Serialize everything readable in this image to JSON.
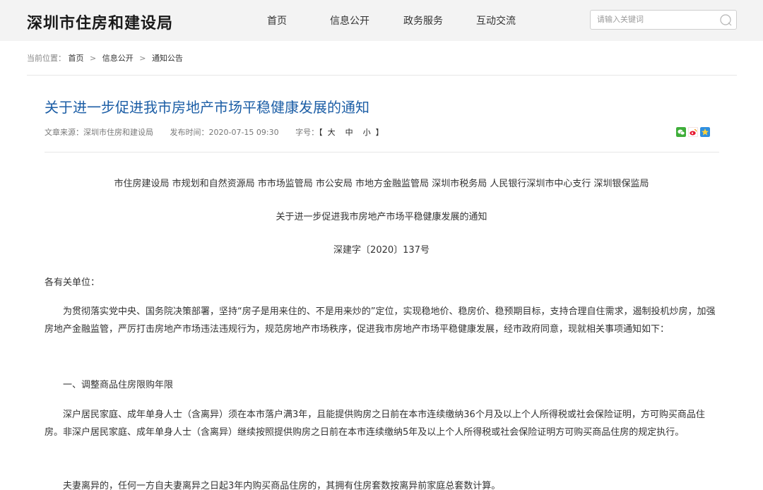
{
  "header": {
    "site_title": "深圳市住房和建设局",
    "nav": [
      "首页",
      "信息公开",
      "政务服务",
      "互动交流"
    ],
    "search_placeholder": "请输入关键词"
  },
  "breadcrumb": {
    "label": "当前位置：",
    "items": [
      "首页",
      "信息公开",
      "通知公告"
    ],
    "separator": ">"
  },
  "article": {
    "title": "关于进一步促进我市房地产市场平稳健康发展的通知",
    "source": "文章来源：深圳市住房和建设局",
    "published": "发布时间：2020-07-15 09:30",
    "fontsize_label": "字号：",
    "fontsize_open": "【",
    "fontsize_options": [
      "大",
      "中",
      "小"
    ],
    "fontsize_close": "】",
    "share_icons": [
      "wechat-share-icon",
      "weibo-share-icon",
      "qzone-share-icon"
    ],
    "body": {
      "recipients": "市住房建设局 市规划和自然资源局 市市场监管局 市公安局 市地方金融监管局 深圳市税务局 人民银行深圳市中心支行 深圳银保监局",
      "doc_title": "关于进一步促进我市房地产市场平稳健康发展的通知",
      "doc_number": "深建字〔2020〕137号",
      "salutation": "各有关单位：",
      "p1": "为贯彻落实党中央、国务院决策部署，坚持“房子是用来住的、不是用来炒的”定位，实现稳地价、稳房价、稳预期目标，支持合理自住需求，遏制投机炒房，加强房地产金融监管，严厉打击房地产市场违法违规行为，规范房地产市场秩序，促进我市房地产市场平稳健康发展，经市政府同意，现就相关事项通知如下：",
      "section1": "一、调整商品住房限购年限",
      "p2": "深户居民家庭、成年单身人士（含离异）须在本市落户满3年，且能提供购房之日前在本市连续缴纳36个月及以上个人所得税或社会保险证明，方可购买商品住房。非深户居民家庭、成年单身人士（含离异）继续按照提供购房之日前在本市连续缴纳5年及以上个人所得税或社会保险证明方可购买商品住房的规定执行。",
      "p3": "夫妻离异的，任何一方自夫妻离异之日起3年内购买商品住房的，其拥有住房套数按离异前家庭总套数计算。"
    }
  },
  "colors": {
    "header_bg": "#f3f3f3",
    "title_blue": "#1c5ea6",
    "text": "#333333"
  }
}
